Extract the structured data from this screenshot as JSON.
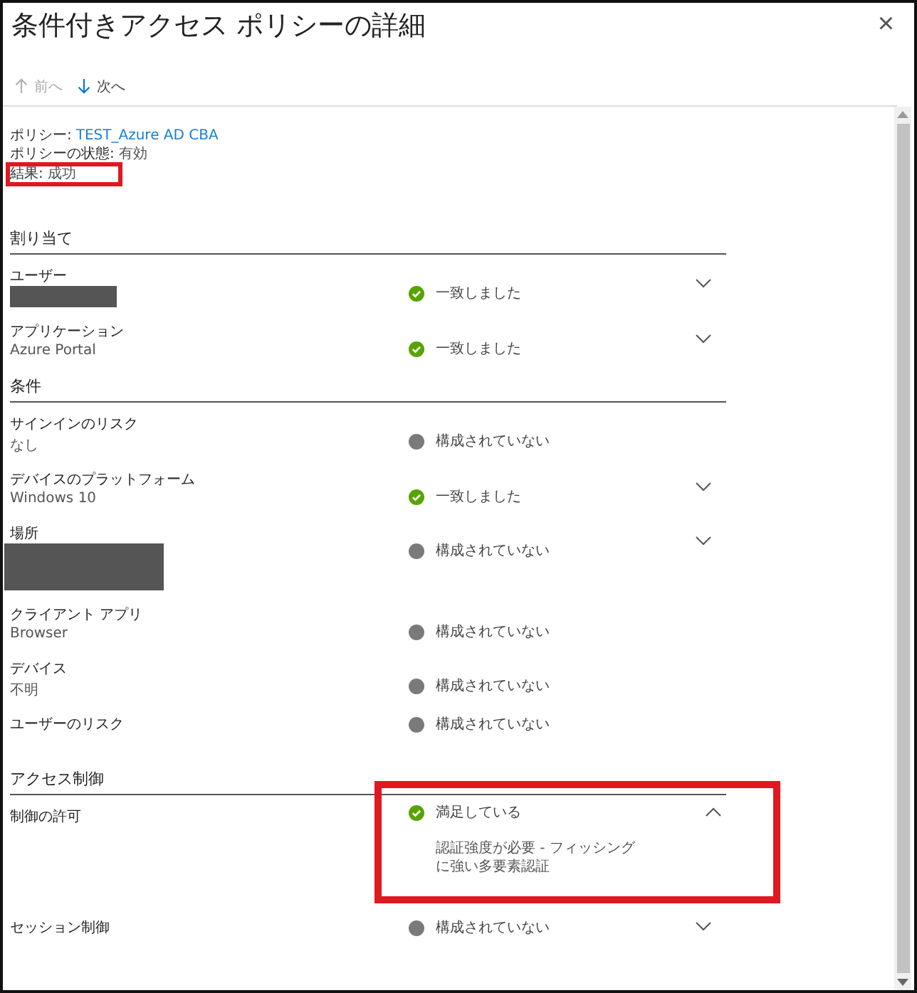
{
  "window": {
    "title": "条件付きアクセス ポリシーの詳細",
    "close": "×"
  },
  "toolbar": [
    {
      "kind": "up",
      "label": "前へ",
      "disabled": true
    },
    {
      "kind": "down",
      "label": "次へ",
      "disabled": false
    }
  ],
  "summary": [
    {
      "label": "ポリシー:",
      "value": "TEST_Azure AD CBA",
      "kind": "link"
    },
    {
      "label": "ポリシーの状態:",
      "value": "有効",
      "kind": "text"
    },
    {
      "label": "結果:",
      "value": "成功",
      "kind": "text",
      "highlighted": true
    }
  ],
  "sections": [
    {
      "title": "割り当て",
      "rows": [
        {
          "label": "ユーザー",
          "kind": "redacted_line",
          "status": {
            "kind": "matched",
            "text": "一致しました"
          },
          "expandable": true,
          "expanded": false
        },
        {
          "label": "アプリケーション",
          "kind": "text",
          "value": "Azure Portal",
          "status": {
            "kind": "matched",
            "text": "一致しました"
          },
          "expandable": true,
          "expanded": false
        }
      ]
    },
    {
      "title": "条件",
      "rows": [
        {
          "label": "サインインのリスク",
          "kind": "text",
          "value": "なし",
          "status": {
            "kind": "not_configured",
            "text": "構成されていない"
          },
          "expandable": false
        },
        {
          "label": "デバイスのプラットフォーム",
          "kind": "text",
          "value": "Windows 10",
          "status": {
            "kind": "matched",
            "text": "一致しました"
          },
          "expandable": true,
          "expanded": false
        },
        {
          "label": "場所",
          "kind": "redacted_block",
          "status": {
            "kind": "not_configured",
            "text": "構成されていない"
          },
          "expandable": true,
          "expanded": false
        },
        {
          "label": "クライアント アプリ",
          "kind": "text",
          "value": "Browser",
          "status": {
            "kind": "not_configured",
            "text": "構成されていない"
          },
          "expandable": false
        },
        {
          "label": "デバイス",
          "kind": "text",
          "value": "不明",
          "status": {
            "kind": "not_configured",
            "text": "構成されていない"
          },
          "expandable": false
        },
        {
          "label": "ユーザーのリスク",
          "kind": "text",
          "status": {
            "kind": "not_configured",
            "text": "構成されていない"
          },
          "expandable": false
        }
      ]
    },
    {
      "title": "アクセス制御",
      "rows": [
        {
          "label": "制御の許可",
          "kind": "text",
          "status": {
            "kind": "matched",
            "text": "満足している"
          },
          "expandable": true,
          "expanded": true,
          "detail": "認証強度が必要 - フィッシングに強い多要素認証",
          "highlighted": true
        },
        {
          "label": "セッション制御",
          "kind": "text",
          "status": {
            "kind": "not_configured",
            "text": "構成されていない"
          },
          "expandable": true,
          "expanded": false
        }
      ]
    }
  ]
}
